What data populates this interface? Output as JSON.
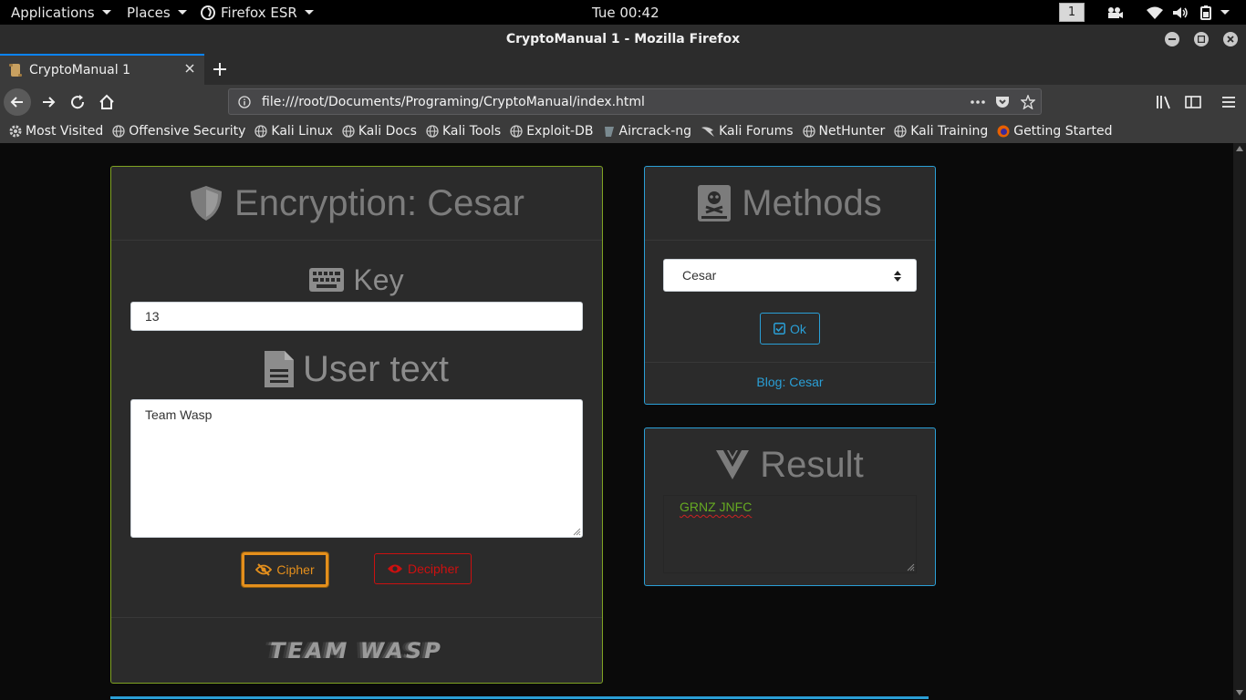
{
  "system_bar": {
    "applications": "Applications",
    "places": "Places",
    "firefox": "Firefox ESR",
    "clock": "Tue 00:42",
    "workspace": "1"
  },
  "window": {
    "title": "CryptoManual 1 - Mozilla Firefox"
  },
  "tab": {
    "label": "CryptoManual 1"
  },
  "urlbar": {
    "url": "file:///root/Documents/Programing/CryptoManual/index.html"
  },
  "bookmarks": [
    "Most Visited",
    "Offensive Security",
    "Kali Linux",
    "Kali Docs",
    "Kali Tools",
    "Exploit-DB",
    "Aircrack-ng",
    "Kali Forums",
    "NetHunter",
    "Kali Training",
    "Getting Started"
  ],
  "encryption_card": {
    "title": "Encryption: Cesar",
    "key_label": "Key",
    "key_value": "13",
    "text_label": "User text",
    "text_value": "Team Wasp",
    "cipher_button": "Cipher",
    "decipher_button": "Decipher",
    "footer_logo": "TEAM WASP"
  },
  "methods_card": {
    "title": "Methods",
    "selected": "Cesar",
    "ok_button": "Ok",
    "blog_link": "Blog: Cesar"
  },
  "result_card": {
    "title": "Result",
    "result_text": "GRNZ JNFC"
  },
  "colors": {
    "encryption_border": "#7fa322",
    "methods_border": "#2a9fd6",
    "cipher_orange": "#e48f1c",
    "decipher_red": "#cc1010",
    "result_green": "#66aa22",
    "link_blue": "#2a9fd6"
  }
}
